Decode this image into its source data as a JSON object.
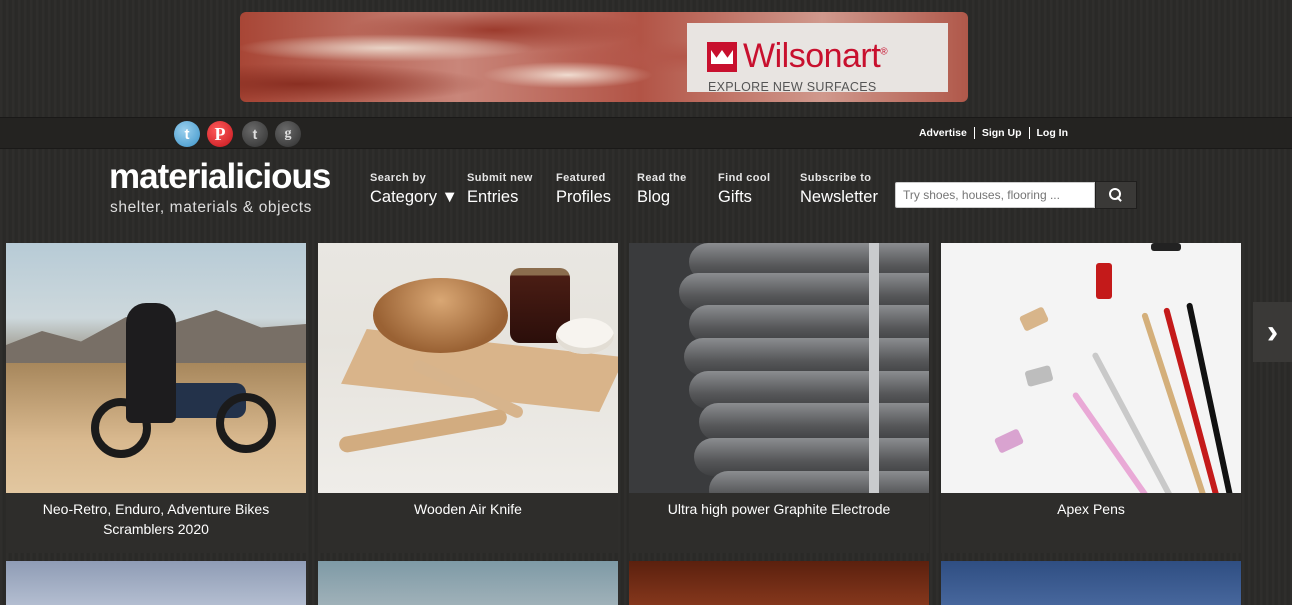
{
  "ad": {
    "brand": "Wilsonart",
    "reg": "®",
    "tagline": "EXPLORE NEW SURFACES"
  },
  "social": {
    "twitter": "t",
    "pinterest": "P",
    "tumblr": "t",
    "google": "g"
  },
  "toplinks": [
    "Advertise",
    "Sign Up",
    "Log In"
  ],
  "logo": {
    "name": "materialicious",
    "tagline": "shelter, materials & objects"
  },
  "nav": [
    {
      "small": "Search by",
      "big": "Category ▼"
    },
    {
      "small": "Submit new",
      "big": "Entries"
    },
    {
      "small": "Featured",
      "big": "Profiles"
    },
    {
      "small": "Read the",
      "big": "Blog"
    },
    {
      "small": "Find cool",
      "big": "Gifts"
    },
    {
      "small": "Subscribe to",
      "big": "Newsletter"
    }
  ],
  "search": {
    "placeholder": "Try shoes, houses, flooring ..."
  },
  "cards": [
    {
      "caption": "Neo-Retro, Enduro, Adventure Bikes Scramblers 2020"
    },
    {
      "caption": "Wooden Air Knife"
    },
    {
      "caption": "Ultra high power Graphite Electrode"
    },
    {
      "caption": "Apex Pens"
    }
  ],
  "next_arrow": "›",
  "colors": {
    "background": "#2b2a28",
    "wilsonart_red": "#c8102e",
    "card_bg": "#2e2d2b"
  }
}
